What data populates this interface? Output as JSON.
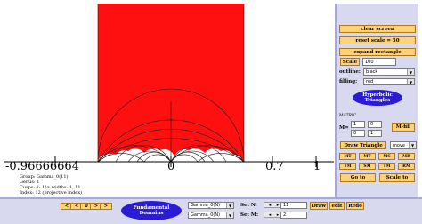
{
  "canvas": {
    "axis_labels": [
      "-0.96666664",
      "0",
      "0.7",
      "1"
    ],
    "info_lines": [
      "Group: Gamma_0(11)",
      "Genus: 1",
      "Cusps: 2:   1/∞   widths:  1, 11",
      "Index: 12 (projective index)"
    ],
    "colors": {
      "domain_fill": "#ff1010",
      "arc_stroke": "#1a1a1a",
      "axis": "#000000"
    }
  },
  "panel": {
    "clear_screen": "clear screen",
    "reset_scale": "reset scale = 50",
    "expand_rectangle": "expand rectangle",
    "scale_button": "Scale",
    "scale_value": "100",
    "outline_label": "outline:",
    "outline_value": "black",
    "filling_label": "filling:",
    "filling_value": "red",
    "hyperbolic_triangles": "Hyperbolic\nTriangles",
    "matrix_label": "MATRIC",
    "m_label": "M=",
    "m11": "1",
    "m12": "0",
    "m21": "0",
    "m22": "1",
    "m_fill_button": "M-fill",
    "draw_triangle": "Draw Triangle",
    "draw_mode": "move",
    "matrix_buttons": [
      "MT",
      "MT",
      "MS",
      "MR",
      "TM",
      "SM",
      "TM",
      "RM"
    ],
    "go_to": "Go to",
    "scale_to": "Scale to",
    "colors": {
      "button": "#ffd27a",
      "pill": "#2a1bd6",
      "panel_bg": "#d8d8ef"
    }
  },
  "bottom": {
    "nav_buttons": [
      "<",
      "<",
      "0",
      ">",
      ">"
    ],
    "fundamental_domains": "Fundamental\nDomains",
    "group_select_1": "Gamma_0(N)",
    "group_select_2": "Gamma_0(N)",
    "set_n_label": "Set N:",
    "set_n_value": "11",
    "set_m_label": "Set M:",
    "set_m_value": "2",
    "draw": "Draw",
    "edit": "edit",
    "redo": "Redo"
  }
}
